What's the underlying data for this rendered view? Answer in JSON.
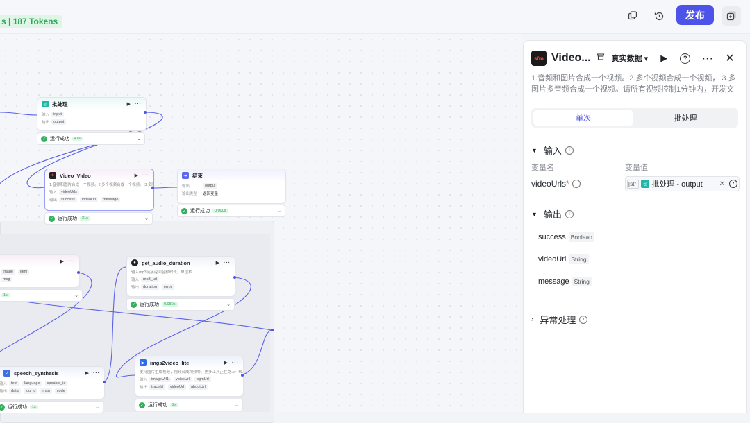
{
  "topbar": {
    "token_badge": "s | 187 Tokens",
    "publish_label": "发布"
  },
  "canvas": {
    "nodes": {
      "batch": {
        "title": "批处理",
        "in_label": "输入",
        "in_val": "input",
        "out_label": "输出",
        "out_val": "output",
        "status": "运行成功",
        "time": "47s"
      },
      "video": {
        "title": "Video_Video",
        "desc": "1.音频和图片合成一个视频。2.多个视频合成一个视频。 3.多图",
        "in_label": "输入",
        "in_val": "videoUrls",
        "out_label": "输出",
        "out1": "success",
        "out2": "videoUrl",
        "out3": "message",
        "status": "运行成功",
        "time": "21s"
      },
      "end": {
        "title": "结束",
        "out_label": "输出",
        "out_val": "output",
        "ret_label": "输出类型",
        "ret_val": "返回变量",
        "status": "运行成功",
        "time": "0.000s"
      },
      "partial": {
        "c1": "image",
        "c2": "item",
        "c3": "msg",
        "time": "1s"
      },
      "dur": {
        "title": "get_audio_duration",
        "desc": "输入mp3链接返回音频时长，单位秒",
        "in_label": "输入",
        "in_val": "mp3_url",
        "out_label": "输出",
        "out1": "duration",
        "out2": "error",
        "status": "运行成功",
        "time": "0.080s"
      },
      "speech": {
        "title": "speech_synthesis",
        "in_label": "输入",
        "i1": "text",
        "i2": "language",
        "i3": "speaker_id",
        "out_label": "输出",
        "o1": "data",
        "o2": "log_id",
        "o3": "msg",
        "o4": "code",
        "status": "运行成功",
        "time": "1s"
      },
      "imgs": {
        "title": "imgs2video_lite",
        "desc": "支持图片生成视频，视频合成视频等。更多工具正在路上~ 帮...",
        "in_label": "输入",
        "i1": "imageUrl1",
        "i2": "voiceUrl",
        "i3": "bgmUrl",
        "out_label": "输出",
        "o1": "traceId",
        "o2": "videoUrl",
        "o3": "aboutUrl",
        "status": "运行成功",
        "time": "2s"
      }
    }
  },
  "panel": {
    "title": "Video...",
    "mode": "真实数据",
    "description": "1.音频和图片合成一个视频。2.多个视频合成一个视频， 3.多图片多音频合成一个视频。请所有视频控制1分钟内，开发文档h...",
    "tabs": {
      "single": "单次",
      "batch": "批处理"
    },
    "input_section": "输入",
    "col_name": "变量名",
    "col_value": "变量值",
    "var_name": "videoUrls",
    "ref_type": "[str]",
    "ref_value": "批处理 - output",
    "output_section": "输出",
    "outputs": [
      {
        "name": "success",
        "type": "Boolean"
      },
      {
        "name": "videoUrl",
        "type": "String"
      },
      {
        "name": "message",
        "type": "String"
      }
    ],
    "error_section": "异常处理"
  }
}
